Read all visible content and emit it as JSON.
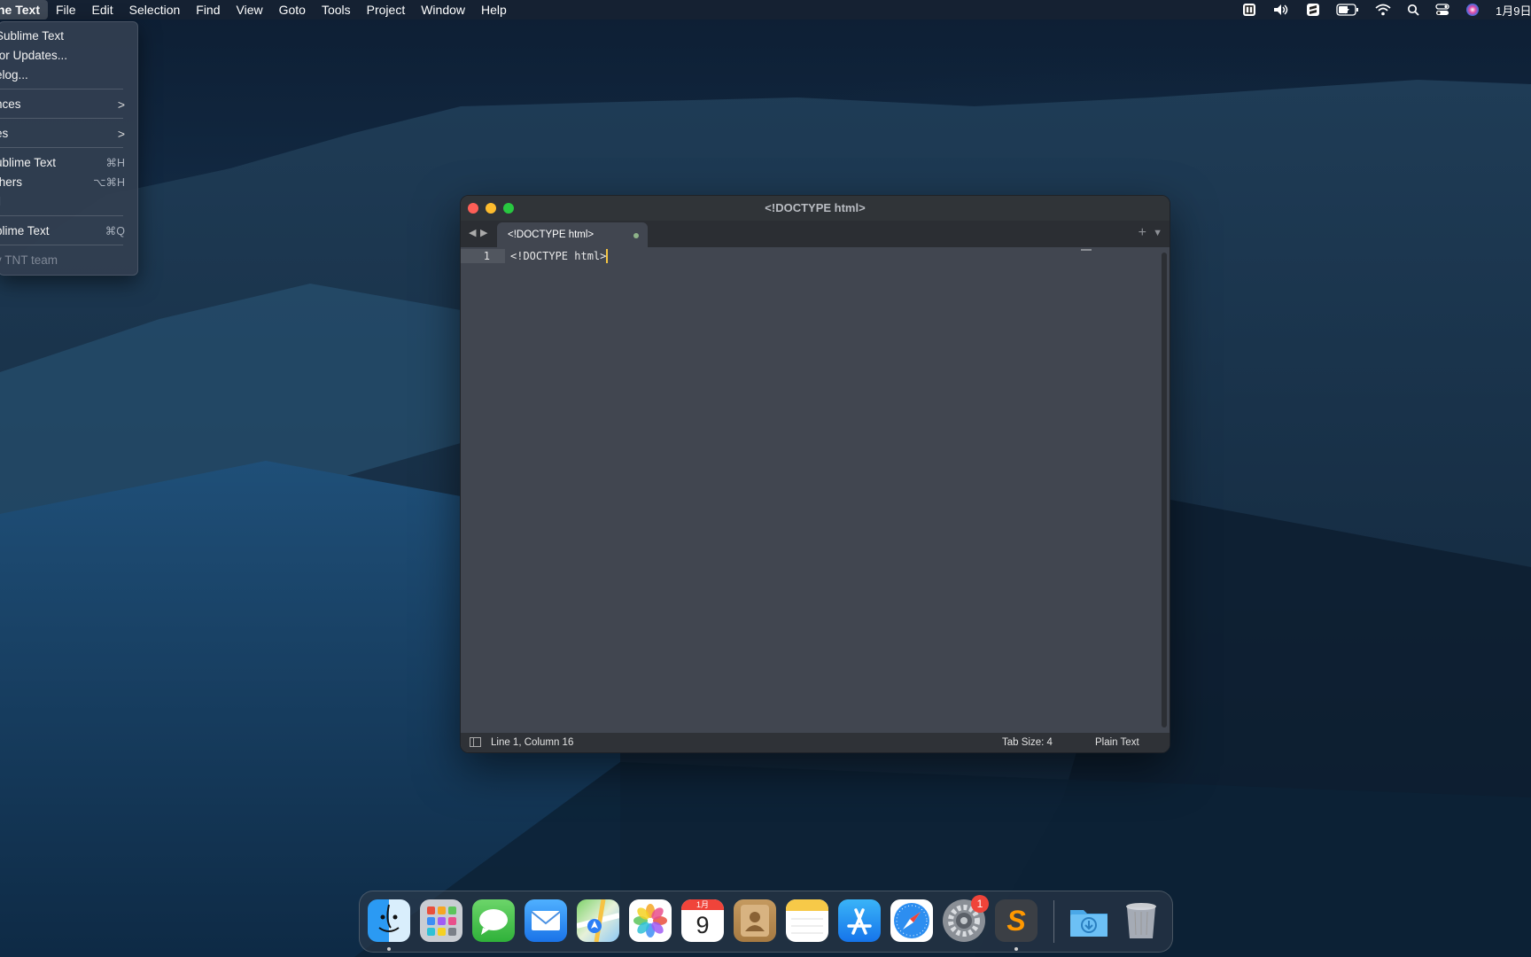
{
  "menubar": {
    "items": [
      "ne Text",
      "File",
      "Edit",
      "Selection",
      "Find",
      "View",
      "Goto",
      "Tools",
      "Project",
      "Window",
      "Help"
    ],
    "clock": "1月9日"
  },
  "app_menu": {
    "items": [
      {
        "label": "Sublime Text",
        "shortcut": "",
        "submenu": false,
        "disabled": false
      },
      {
        "label": "for Updates...",
        "shortcut": "",
        "submenu": false,
        "disabled": false
      },
      {
        "label": "elog...",
        "shortcut": "",
        "submenu": false,
        "disabled": false
      },
      {
        "label": "nces",
        "shortcut": "",
        "submenu": true,
        "disabled": false
      },
      {
        "label": "es",
        "shortcut": "",
        "submenu": true,
        "disabled": false
      },
      {
        "label": "ublime Text",
        "shortcut": "⌘H",
        "submenu": false,
        "disabled": false
      },
      {
        "label": "thers",
        "shortcut": "⌥⌘H",
        "submenu": false,
        "disabled": false
      },
      {
        "label": "ll",
        "shortcut": "",
        "submenu": false,
        "disabled": true
      },
      {
        "label": "blime Text",
        "shortcut": "⌘Q",
        "submenu": false,
        "disabled": false
      },
      {
        "label": "y TNT team",
        "shortcut": "",
        "submenu": false,
        "disabled": true
      }
    ],
    "chevron": ">"
  },
  "window": {
    "title": "<!DOCTYPE html>",
    "tab_label": "<!DOCTYPE html>",
    "line_number": "1",
    "code_line": "<!DOCTYPE html>",
    "status_position": "Line 1, Column 16",
    "status_tab_size": "Tab Size: 4",
    "status_syntax": "Plain Text",
    "nav_back": "◀",
    "nav_forward": "▶",
    "new_tab": "+",
    "tab_menu": "▼"
  },
  "dock": {
    "calendar_month": "1月",
    "calendar_day": "9",
    "settings_badge": "1",
    "sublime_glyph": "S"
  },
  "colors": {
    "close": "#fe5f57",
    "minimize": "#febc2e",
    "zoom": "#28c840",
    "caret": "#f5c542"
  }
}
